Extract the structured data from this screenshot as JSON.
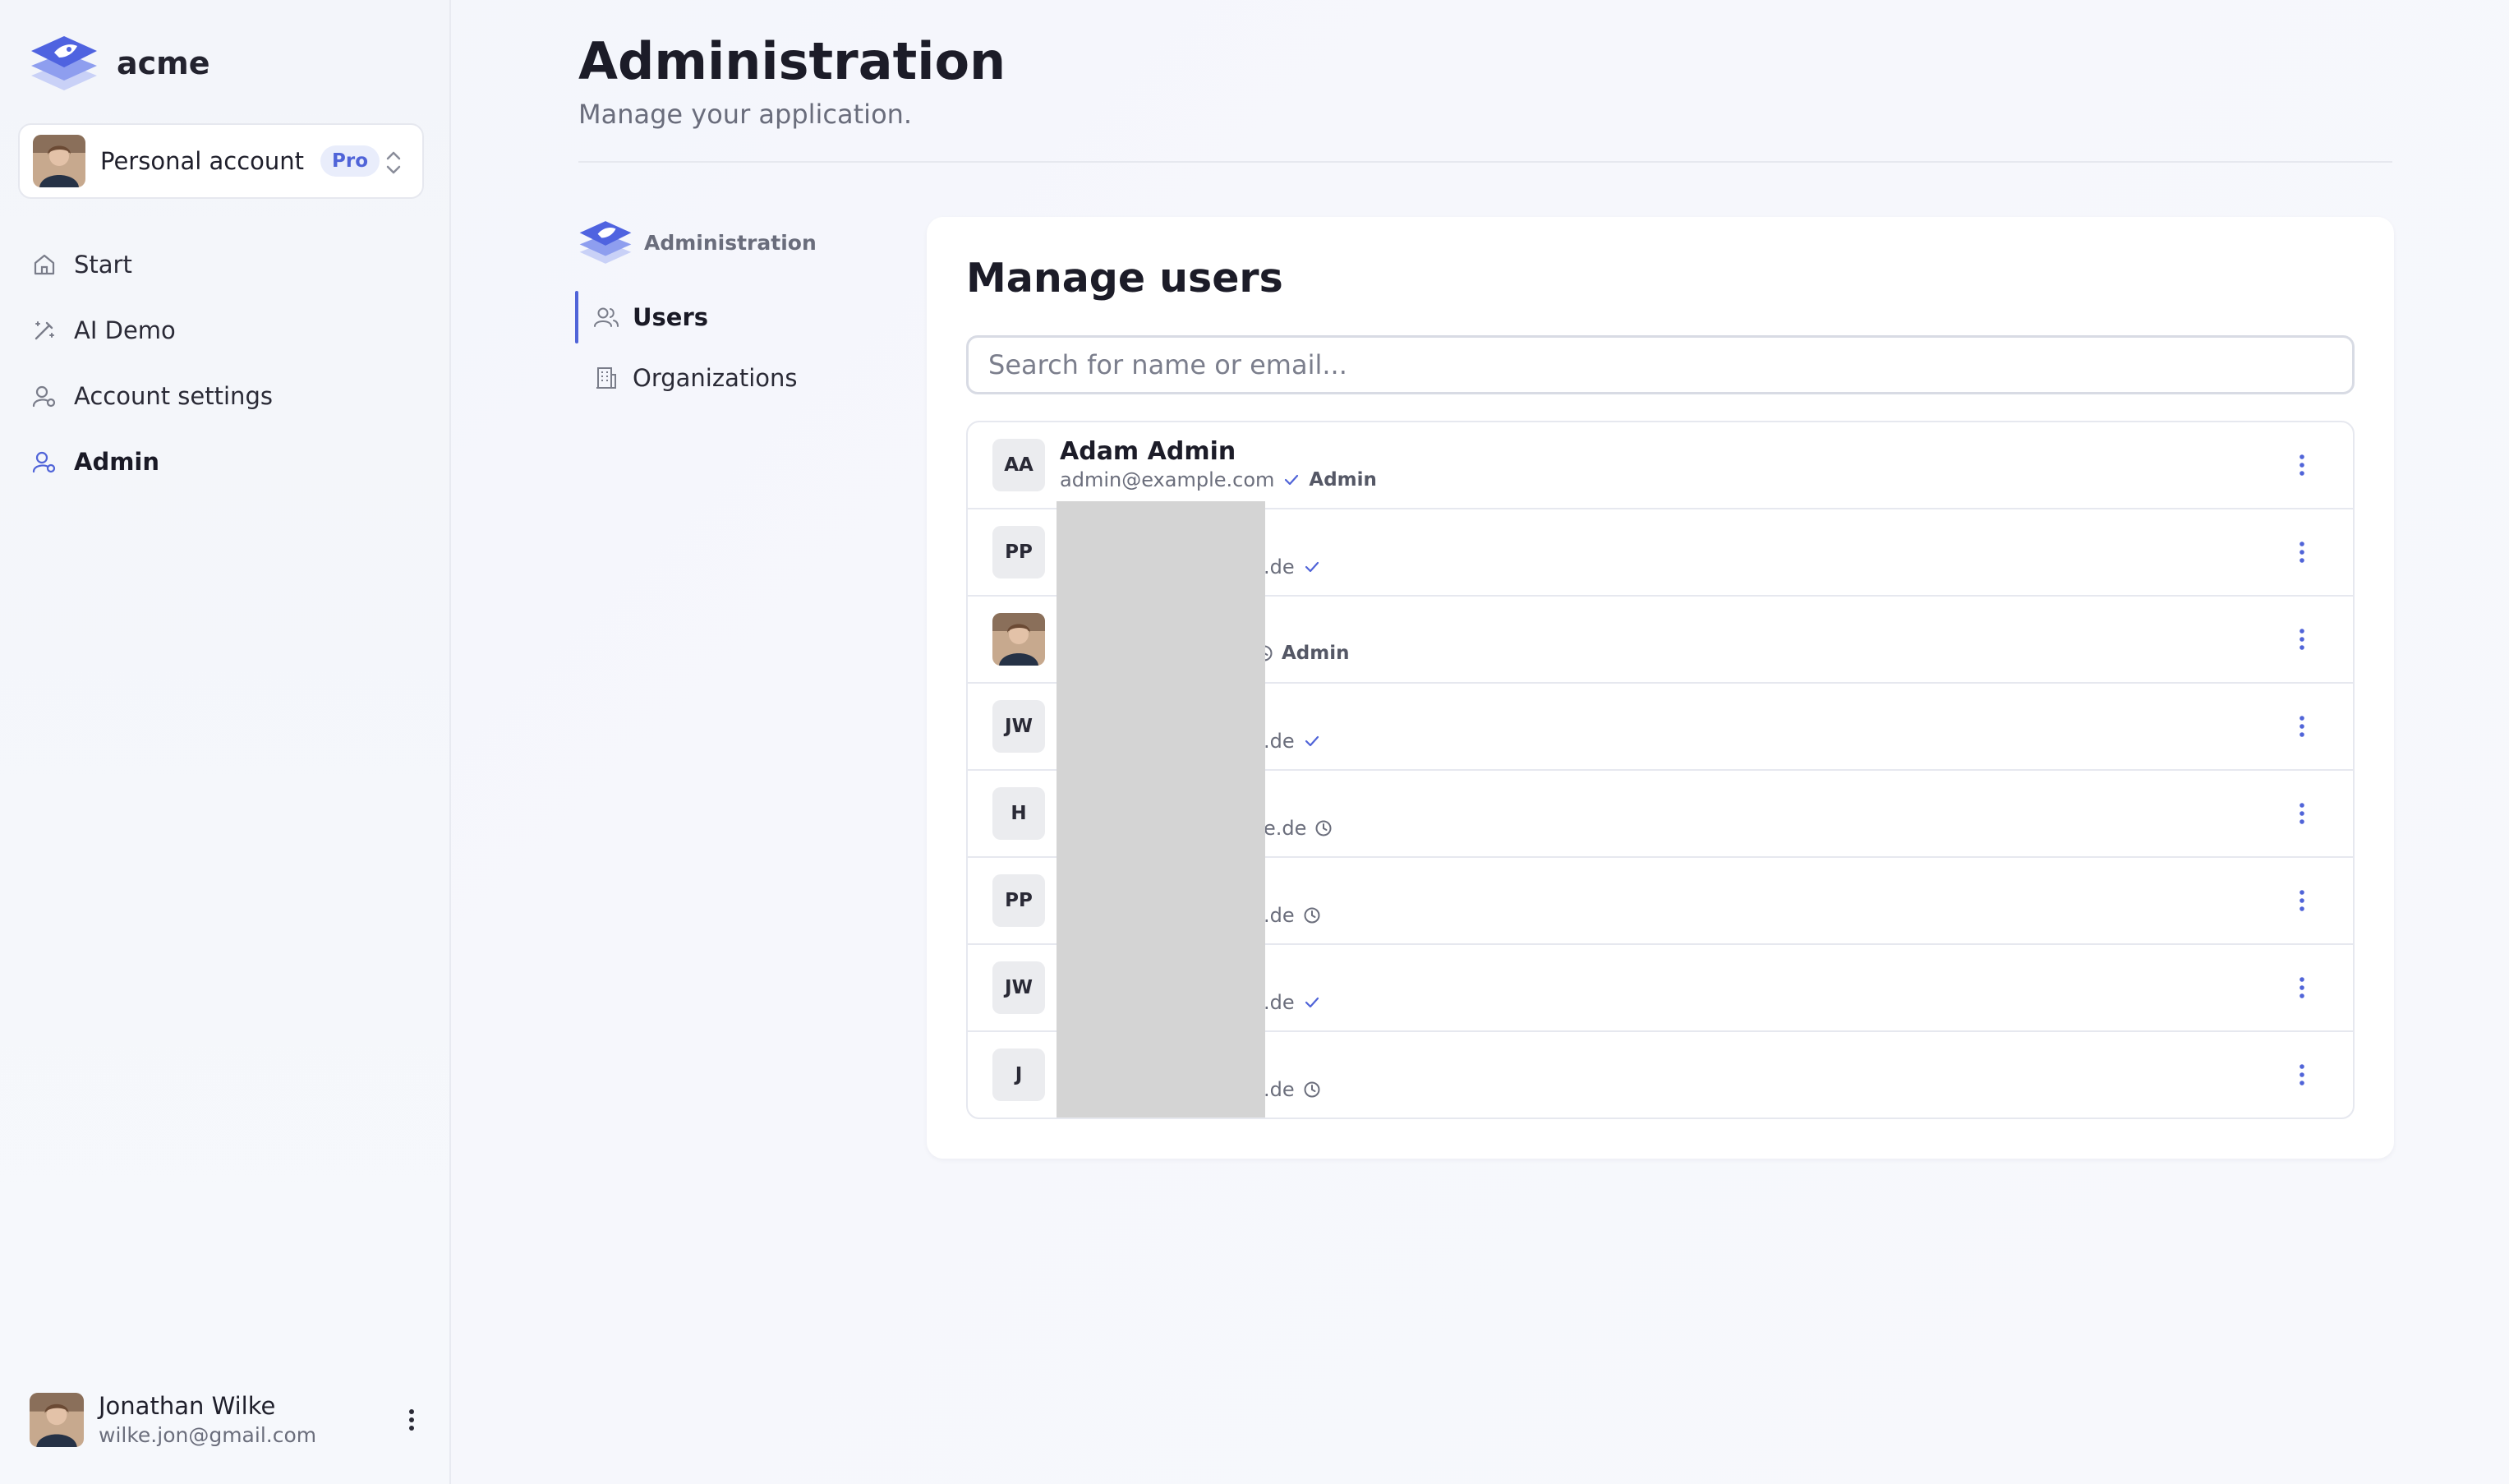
{
  "brand": {
    "name": "acme"
  },
  "account": {
    "name": "Personal account",
    "badge": "Pro"
  },
  "nav": {
    "items": [
      {
        "label": "Start",
        "icon": "home-icon"
      },
      {
        "label": "AI Demo",
        "icon": "wand-icon"
      },
      {
        "label": "Account settings",
        "icon": "user-cog-icon"
      },
      {
        "label": "Admin",
        "icon": "user-shield-icon",
        "active": true
      }
    ]
  },
  "current_user": {
    "name": "Jonathan Wilke",
    "email": "wilke.jon@gmail.com"
  },
  "page": {
    "title": "Administration",
    "subtitle": "Manage your application."
  },
  "subnav": {
    "heading": "Administration",
    "items": [
      {
        "label": "Users",
        "icon": "users-icon",
        "active": true
      },
      {
        "label": "Organizations",
        "icon": "building-icon"
      }
    ]
  },
  "manage_users": {
    "title": "Manage users",
    "search_placeholder": "Search for name or email...",
    "users": [
      {
        "initials": "AA",
        "name": "Adam Admin",
        "email": "admin@example.com",
        "status": "verified",
        "role": "Admin"
      },
      {
        "initials": "PP",
        "email_suffix": ".de",
        "status": "verified"
      },
      {
        "avatar": "photo",
        "status": "pending",
        "role": "Admin"
      },
      {
        "initials": "JW",
        "email_suffix": ".de",
        "status": "verified"
      },
      {
        "initials": "H",
        "email_suffix": "e.de",
        "status": "pending"
      },
      {
        "initials": "PP",
        "email_suffix": ".de",
        "status": "pending"
      },
      {
        "initials": "JW",
        "email_suffix": ".de",
        "status": "verified"
      },
      {
        "initials": "J",
        "email_suffix": ".de",
        "status": "pending"
      }
    ]
  },
  "colors": {
    "accent": "#5064d8",
    "redaction": "#d4d4d4"
  }
}
